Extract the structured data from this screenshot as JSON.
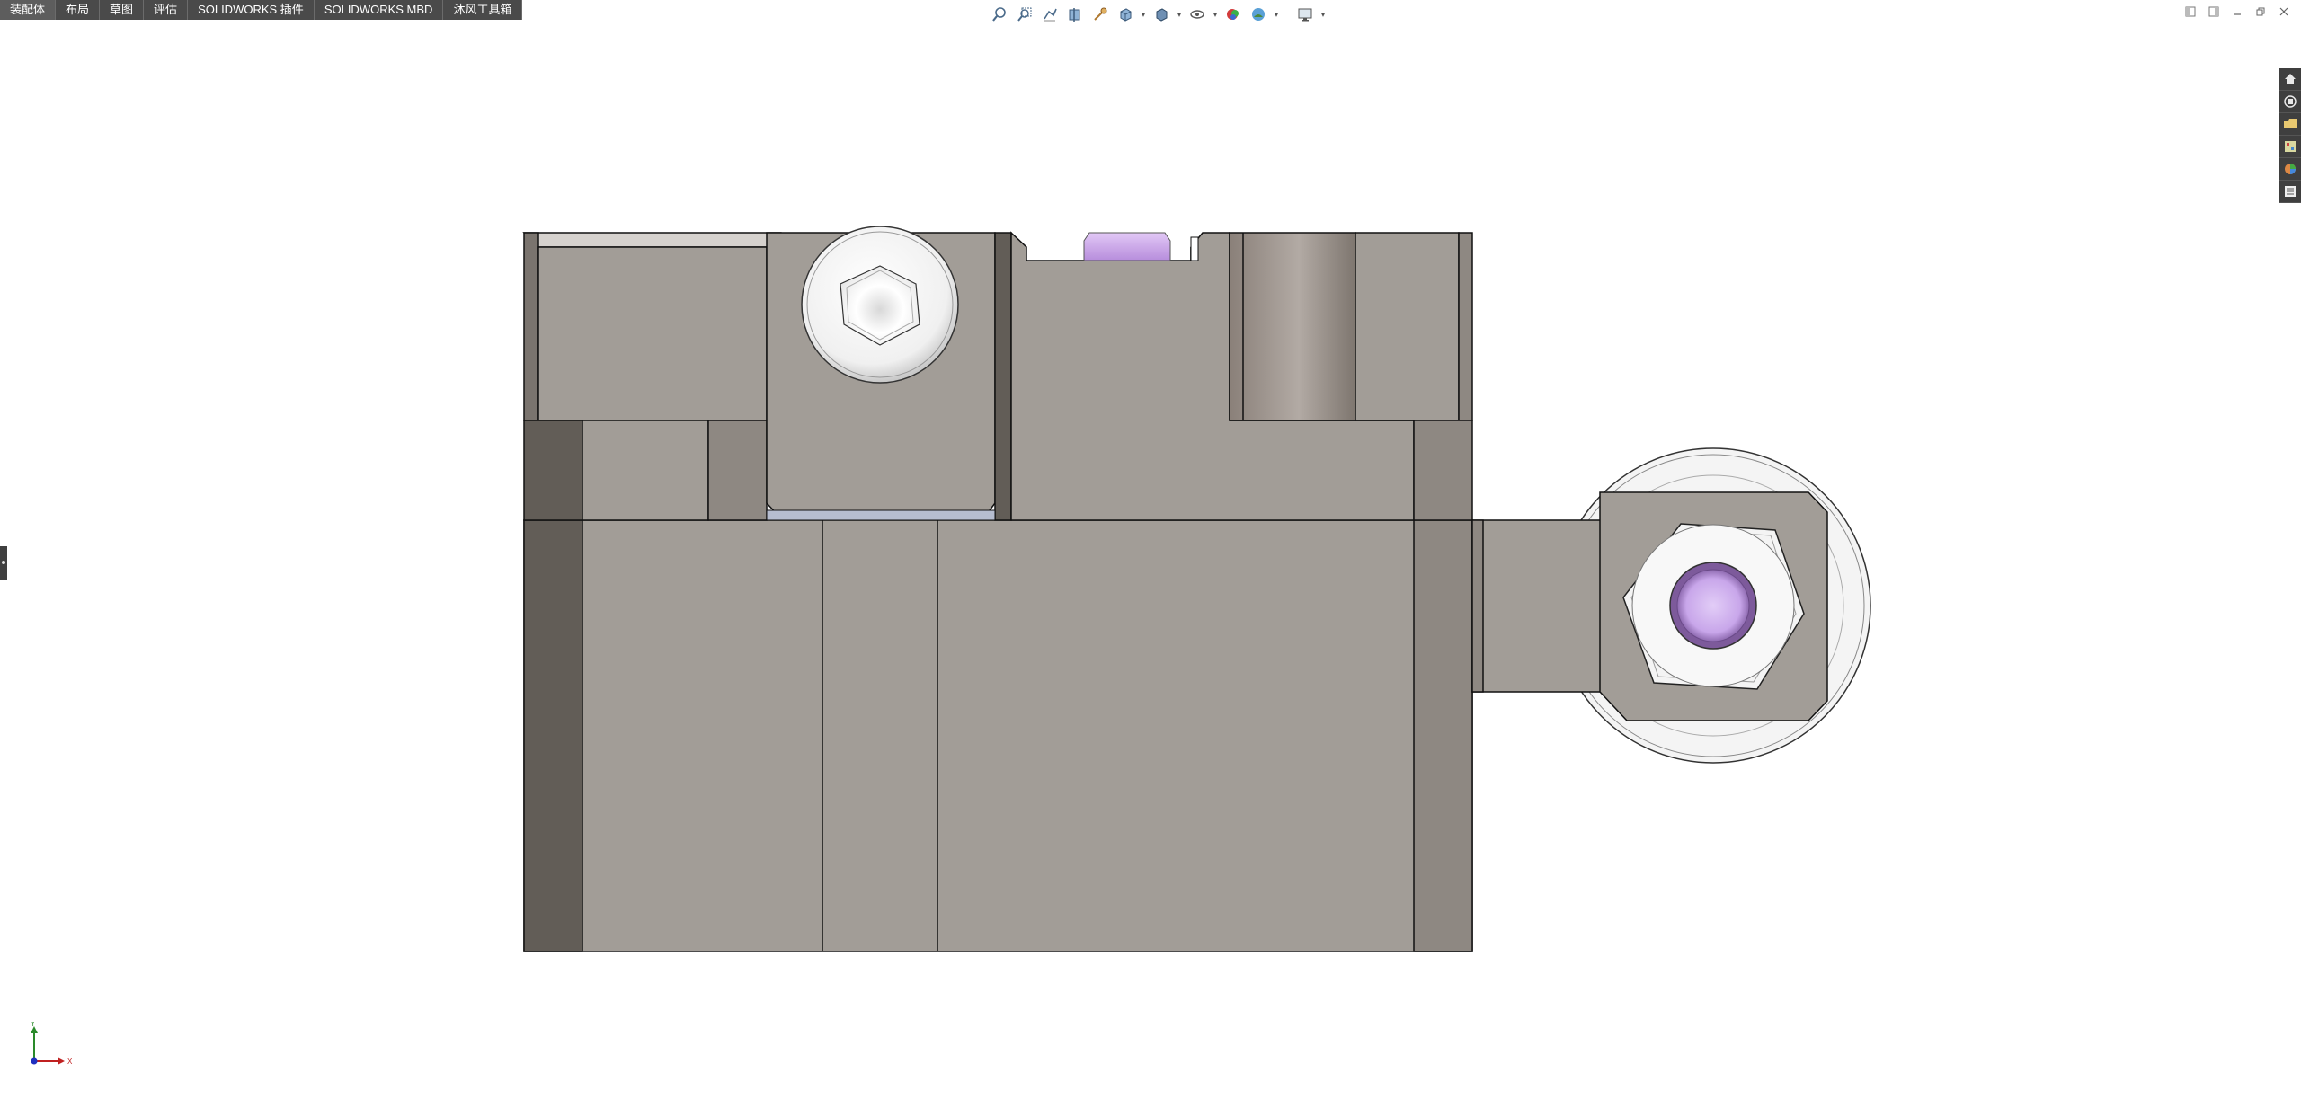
{
  "command_tabs": [
    {
      "label": "装配体"
    },
    {
      "label": "布局"
    },
    {
      "label": "草图"
    },
    {
      "label": "评估"
    },
    {
      "label": "SOLIDWORKS 插件"
    },
    {
      "label": "SOLIDWORKS MBD"
    },
    {
      "label": "沐风工具箱"
    }
  ],
  "hud_toolbar": {
    "icons": [
      "zoom-to-fit-icon",
      "zoom-to-area-icon",
      "previous-view-icon",
      "section-view-icon",
      "dynamic-annotation-icon",
      "view-orientation-icon",
      "display-style-icon",
      "hide-show-items-icon",
      "edit-appearance-icon",
      "apply-scene-icon",
      "view-settings-icon"
    ]
  },
  "window_controls": [
    "tile-left-icon",
    "tile-right-icon",
    "minimize-icon",
    "restore-icon",
    "close-icon"
  ],
  "task_pane": [
    "home-icon",
    "resources-icon",
    "design-library-icon",
    "file-explorer-icon",
    "appearances-icon",
    "custom-properties-icon"
  ],
  "triad": {
    "y_label": "Y",
    "x_label": "X"
  },
  "colors": {
    "part_face": "#a29d97",
    "part_shadow": "#625d57",
    "part_mid": "#8e8882",
    "bolt": "#f0f0f0",
    "pin": "#c7a4e6",
    "toolbar_bg": "#4a4a4a"
  }
}
